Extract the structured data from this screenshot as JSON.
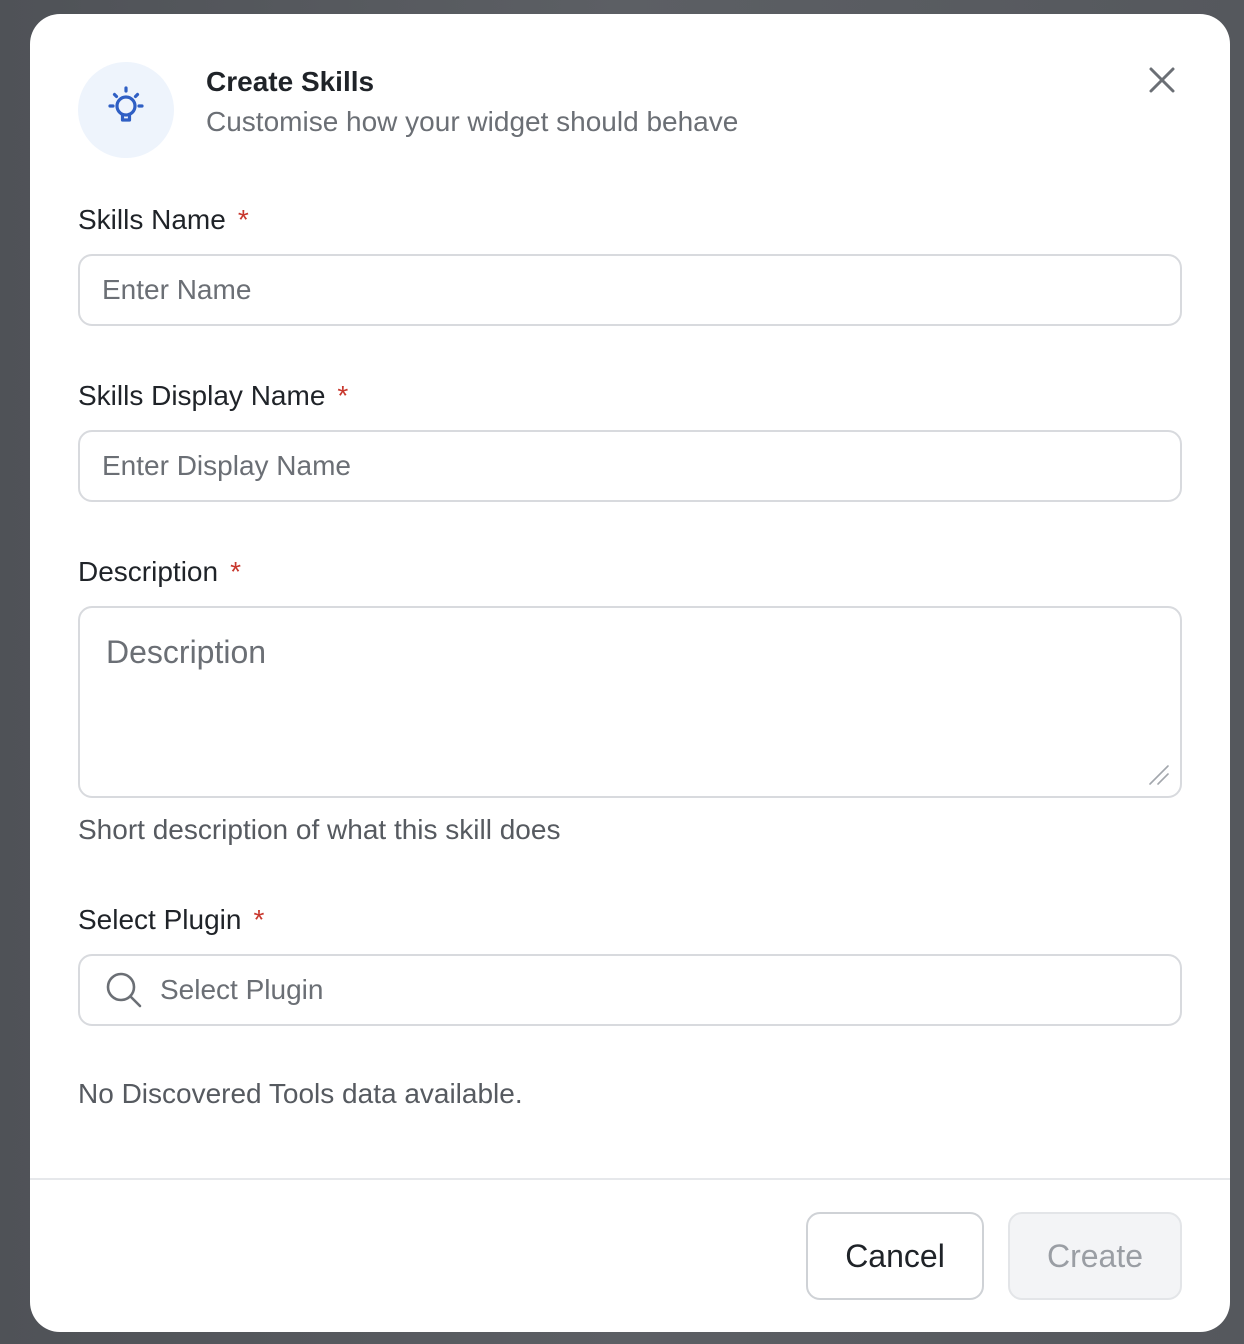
{
  "header": {
    "title": "Create Skills",
    "subtitle": "Customise how your widget should behave",
    "icon": "lightbulb-icon",
    "close_icon": "close-icon"
  },
  "form": {
    "skills_name": {
      "label": "Skills Name",
      "required_mark": "*",
      "value": "",
      "placeholder": "Enter Name"
    },
    "skills_display_name": {
      "label": "Skills Display Name",
      "required_mark": "*",
      "value": "",
      "placeholder": "Enter Display Name"
    },
    "description": {
      "label": "Description",
      "required_mark": "*",
      "value": "",
      "placeholder": "Description",
      "helper": "Short description of what this skill does"
    },
    "select_plugin": {
      "label": "Select Plugin",
      "required_mark": "*",
      "value": "",
      "placeholder": "Select Plugin",
      "icon": "search-icon"
    },
    "empty_message": "No Discovered Tools data available."
  },
  "footer": {
    "cancel_label": "Cancel",
    "create_label": "Create",
    "create_disabled": true
  },
  "colors": {
    "accent_icon": "#2f5fc4",
    "icon_badge_bg": "#eef4fc",
    "required": "#c8372d",
    "overlay": "#55585d"
  }
}
